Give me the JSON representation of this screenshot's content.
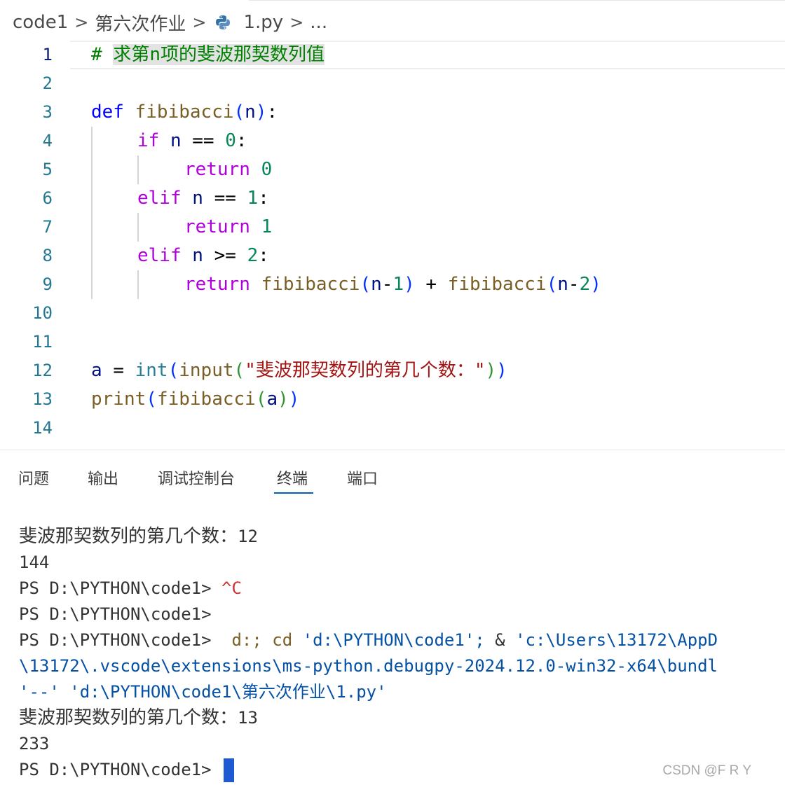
{
  "breadcrumb": {
    "items": [
      "code1",
      "第六次作业",
      "1.py",
      "..."
    ],
    "separator": ">"
  },
  "editor": {
    "lines": [
      {
        "n": "1",
        "active": true
      },
      {
        "n": "2"
      },
      {
        "n": "3"
      },
      {
        "n": "4"
      },
      {
        "n": "5"
      },
      {
        "n": "6"
      },
      {
        "n": "7"
      },
      {
        "n": "8"
      },
      {
        "n": "9"
      },
      {
        "n": "10"
      },
      {
        "n": "11"
      },
      {
        "n": "12"
      },
      {
        "n": "13"
      },
      {
        "n": "14"
      }
    ],
    "code": {
      "l1_hash": "#",
      "l1_comment": "求第n项的斐波那契数列值",
      "l3_def": "def",
      "l3_name": "fibibacci",
      "l3_param": "n",
      "l4_if": "if",
      "l4_n": "n",
      "l4_op": "==",
      "l4_num": "0",
      "l5_return": "return",
      "l5_num": "0",
      "l6_elif": "elif",
      "l6_n": "n",
      "l6_op": "==",
      "l6_num": "1",
      "l7_return": "return",
      "l7_num": "1",
      "l8_elif": "elif",
      "l8_n": "n",
      "l8_op": ">=",
      "l8_num": "2",
      "l9_return": "return",
      "l9_call1": "fibibacci",
      "l9_arg1n": "n",
      "l9_arg1m": "-",
      "l9_arg1v": "1",
      "l9_plus": "+",
      "l9_call2": "fibibacci",
      "l9_arg2n": "n",
      "l9_arg2m": "-",
      "l9_arg2v": "2",
      "l12_var": "a",
      "l12_eq": "=",
      "l12_int": "int",
      "l12_input": "input",
      "l12_str": "\"斐波那契数列的第几个数：\"",
      "l13_print": "print",
      "l13_call": "fibibacci",
      "l13_arg": "a"
    }
  },
  "panel": {
    "tabs": [
      {
        "label": "问题"
      },
      {
        "label": "输出"
      },
      {
        "label": "调试控制台"
      },
      {
        "label": "终端",
        "active": true
      },
      {
        "label": "端口"
      }
    ]
  },
  "terminal": {
    "prompt_cn": "斐波那契数列的第几个数：",
    "input1": "12",
    "out1": "144",
    "ps": "PS D:\\PYTHON\\code1>",
    "ctrl_c": "^C",
    "cmd_d": "d:;",
    "cmd_cd": "cd",
    "cmd_path": "'d:\\PYTHON\\code1';",
    "cmd_amp": "&",
    "cmd_exe": "'c:\\Users\\13172\\AppD",
    "cmd_line2": "\\13172\\.vscode\\extensions\\ms-python.debugpy-2024.12.0-win32-x64\\bundl",
    "cmd_line3": "'--' 'd:\\PYTHON\\code1\\第六次作业\\1.py'",
    "input2": "13",
    "out2": "233"
  },
  "watermark": "CSDN @F R Y",
  "colors": {
    "keyword": "#0000ff",
    "control": "#af00db",
    "function": "#795e26",
    "comment": "#008000",
    "number": "#098658",
    "string": "#a31515",
    "line_number": "#237893",
    "tab_underline": "#005fb8",
    "cursor": "#1e5ad2"
  }
}
